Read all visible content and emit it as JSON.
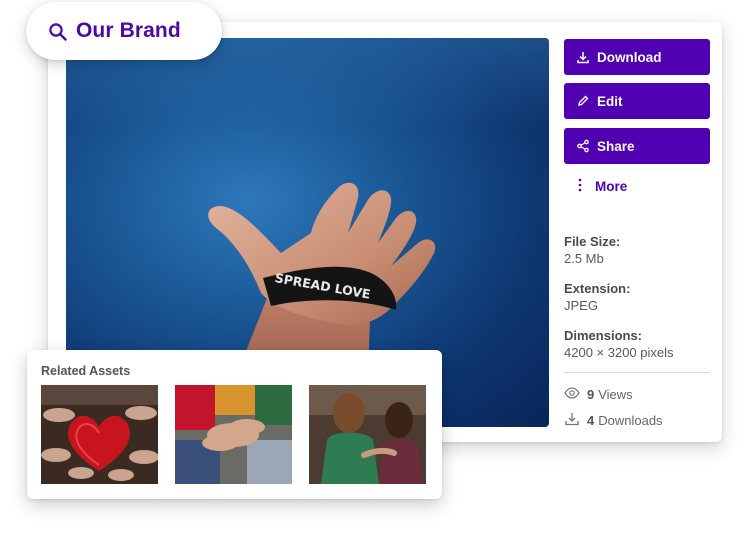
{
  "search": {
    "brand": "Our Brand",
    "icon": "search-icon"
  },
  "actions": {
    "download": "Download",
    "edit": "Edit",
    "share": "Share",
    "more": "More"
  },
  "hero": {
    "wristband_text": "SPREAD LOVE"
  },
  "meta": {
    "file_size_label": "File Size:",
    "file_size_value": "2.5 Mb",
    "extension_label": "Extension:",
    "extension_value": "JPEG",
    "dimensions_label": "Dimensions:",
    "dimensions_value": "4200 × 3200 pixels"
  },
  "stats": {
    "views_count": "9",
    "views_label": "Views",
    "downloads_count": "4",
    "downloads_label": "Downloads"
  },
  "related": {
    "title": "Related Assets"
  },
  "colors": {
    "accent": "#5000b0",
    "brand_text": "#4e08a5"
  }
}
